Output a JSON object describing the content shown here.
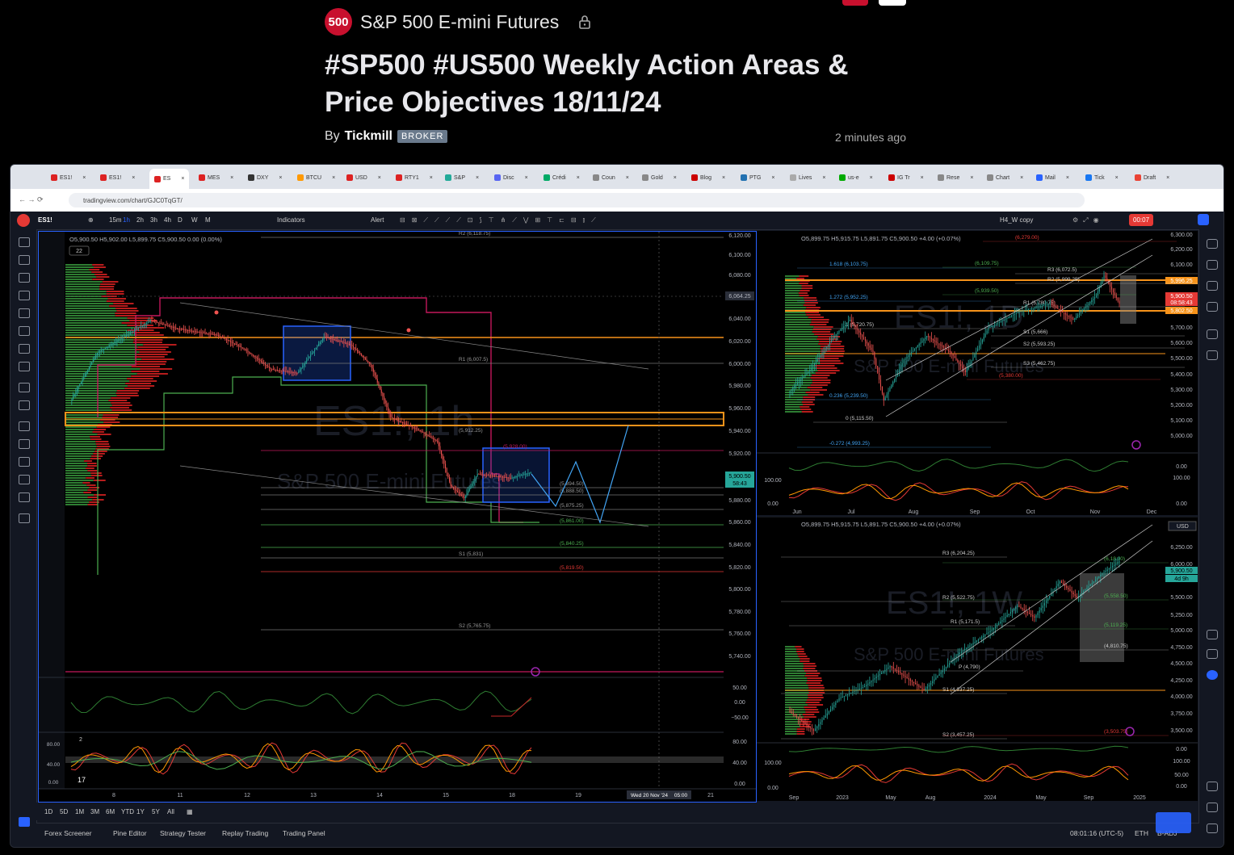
{
  "symbol": {
    "badge": "500",
    "name": "S&P 500 E-mini Futures"
  },
  "headline": "#SP500 #US500 Weekly Action Areas & Price Objectives 18/11/24",
  "byline": {
    "prefix": "By",
    "author": "Tickmill",
    "badge": "BROKER",
    "time": "2 minutes ago"
  },
  "browser": {
    "tabs": [
      "ES1!",
      "ES1!",
      "ES",
      "MES",
      "DXY",
      "BTCU",
      "USD",
      "RTY1",
      "S&P",
      "Disc",
      "Crédi",
      "Coun",
      "Gold",
      "Blog",
      "PTG",
      "Lives",
      "us-e",
      "IG Tr",
      "Rese",
      "Chart",
      "Mail",
      "Tick",
      "Draft"
    ],
    "url": "tradingview.com/chart/GJC0TqGT/"
  },
  "toolbar": {
    "ticker": "ES1!",
    "intervals": [
      "15m",
      "1h",
      "2h",
      "3h",
      "4h",
      "D",
      "W",
      "M"
    ],
    "indicators": "Indicators",
    "alert": "Alert",
    "layout": "H4_W copy",
    "timer": "00:07"
  },
  "main_chart": {
    "ohlc": {
      "o": "O5,900.50",
      "h": "H5,902.00",
      "l": "L5,899.75",
      "c": "C5,900.50",
      "chg": "0.00 (0.00%)"
    },
    "count": "22",
    "watermark_sym": "ES1!, 1h",
    "watermark_name": "S&P 500 E-mini Futures",
    "price_axis": [
      "6,120.00",
      "6,100.00",
      "6,080.00",
      "6,064.25",
      "6,040.00",
      "6,020.00",
      "6,000.00",
      "5,980.00",
      "5,960.00",
      "5,940.00",
      "5,920.00",
      "5,900.50",
      "58:43",
      "5,880.00",
      "5,860.00",
      "5,840.00",
      "5,820.00",
      "5,800.00",
      "5,780.00",
      "5,760.00",
      "5,740.00"
    ],
    "levels": [
      "R2 (6,118.75)",
      "R1 (6,007.5)",
      "(5,928.00)",
      "(5,894.50)",
      "(5,888.50)",
      "(5,875.25)",
      "(5,861.00)",
      "(5,840.25)",
      "S1 (5,831)",
      "(5,819.50)",
      "S2 (5,765.75)",
      "(5,912.25)"
    ],
    "osc_axis": [
      "50.00",
      "0.00",
      "−50.00"
    ],
    "stoch_label": "2",
    "stoch_axis": [
      "80.00",
      "40.00",
      "0.00"
    ],
    "stoch_left": [
      "80.00",
      "40.00",
      "0.00"
    ],
    "time_axis": [
      "8",
      "11",
      "12",
      "13",
      "14",
      "15",
      "18",
      "19",
      "21"
    ],
    "crosshair_time": "Wed 20 Nov '24",
    "crosshair_clock": "05:00"
  },
  "daily_chart": {
    "ohlc": "O5,899.75 H5,915.75 L5,891.75 C5,900.50 +4.00 (+0.07%)",
    "watermark_sym": "ES1!, 1D",
    "watermark_name": "S&P 500 E-mini Futures",
    "price_axis": [
      "6,300.00",
      "6,200.00",
      "6,100.00",
      "5,996.25",
      "5,900.50",
      "08:58:43",
      "5,802.50",
      "5,700.00",
      "5,600.00",
      "5,500.00",
      "5,400.00",
      "5,300.00",
      "5,200.00",
      "5,100.00",
      "5,000.00"
    ],
    "fib_levels": [
      "(6,279.00)",
      "1.618 (6,103.75)",
      "(6,109.75)",
      "R3 (6,072.5)",
      "R2 (5,999.25)",
      "1.272 (5,952.25)",
      "(5,939.50)",
      "R1 (5,780.75)",
      "1 (5,720.75)",
      "S1 (5,666)",
      "S2 (5,593.25)",
      "S3 (5,462.75)",
      "(5,380.00)",
      "0.236 (5,239.50)",
      "0 (5,115.50)",
      "-0.272 (4,993.25)"
    ],
    "osc_axis": [
      "0.00",
      "100.00",
      "0.00"
    ],
    "time_axis": [
      "Jun",
      "Jul",
      "Aug",
      "Sep",
      "Oct",
      "Nov",
      "Dec"
    ]
  },
  "weekly_chart": {
    "ohlc": "O5,899.75 H5,915.75 L5,891.75 C5,900.50 +4.00 (+0.07%)",
    "currency": "USD",
    "watermark_sym": "ES1!, 1W",
    "watermark_name": "S&P 500 E-mini Futures",
    "price_axis": [
      "6,250.00",
      "6,000.00",
      "5,900.50",
      "4d 9h",
      "5,500.00",
      "5,250.00",
      "5,000.00",
      "4,750.00",
      "4,500.00",
      "4,250.00",
      "4,000.00",
      "3,750.00",
      "3,500.00",
      "0.00",
      "100.00",
      "50.00",
      "0.00"
    ],
    "levels": [
      "R3 (6,204.25)",
      "(6,18.00)",
      "R2 (5,522.75)",
      "(5,558.50)",
      "R1 (5,171.5)",
      "(5,119.25)",
      "(4,810.75)",
      "P (4,790)",
      "S1 (4,337.25)",
      "S2 (3,457.25)",
      "(3,503.75)"
    ],
    "time_axis": [
      "Sep",
      "2023",
      "May",
      "Aug",
      "2024",
      "May",
      "Sep",
      "2025"
    ]
  },
  "range_bar": [
    "1D",
    "5D",
    "1M",
    "3M",
    "6M",
    "YTD",
    "1Y",
    "5Y",
    "All"
  ],
  "status": {
    "clock": "08:01:16 (UTC-5)",
    "session": "ETH",
    "mode": "B-ADJ"
  },
  "footer_tabs": [
    "Forex Screener",
    "Pine Editor",
    "Strategy Tester",
    "Replay Trading",
    "Trading Panel"
  ],
  "icons": [
    "lock-icon",
    "crosshair-icon",
    "trendline-icon",
    "fib-icon",
    "text-icon",
    "measure-icon",
    "zoom-icon",
    "magnet-icon",
    "eye-icon",
    "trash-icon",
    "watchlist-icon",
    "alerts-icon",
    "layers-icon",
    "calendar-icon",
    "help-icon"
  ],
  "colors": {
    "up": "#26a69a",
    "down": "#ef5350",
    "orange": "#f7931a",
    "magenta": "#e91e63",
    "blue": "#2962ff",
    "badge": "#c8102e"
  }
}
